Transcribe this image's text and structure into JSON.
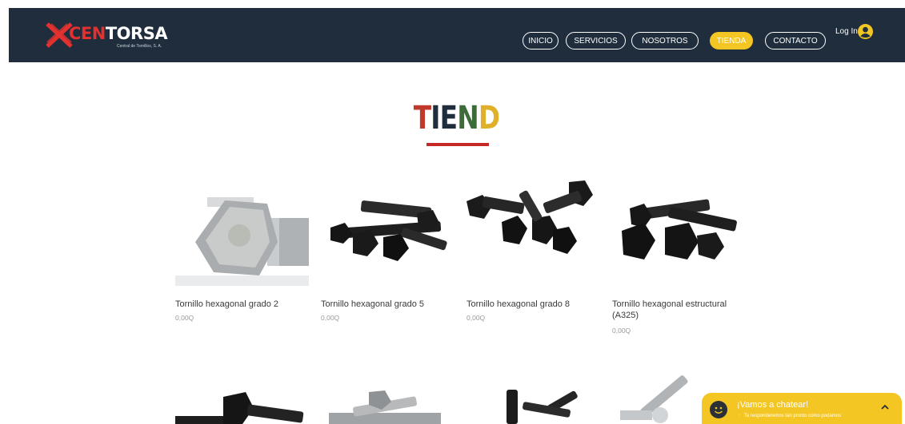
{
  "header": {
    "logo": {
      "brand_red": "CEN",
      "brand_white": "TORSA",
      "subtitle": "Central de Tornillos, S. A."
    },
    "nav": [
      {
        "label": "INICIO"
      },
      {
        "label": "SERVICIOS"
      },
      {
        "label": "NOSOTROS"
      },
      {
        "label": "TIENDA",
        "active": true
      },
      {
        "label": "CONTACTO"
      }
    ],
    "login_label": "Log In",
    "colors": {
      "background": "#1f2d3d",
      "accent": "#f3c623",
      "brand_red": "#e2312f"
    }
  },
  "page": {
    "title": "TIENDA"
  },
  "products": [
    {
      "name": "Tornillo hexagonal grado 2",
      "price": "0,00Q",
      "image": "zinc-hex-bolt"
    },
    {
      "name": "Tornillo hexagonal grado 5",
      "price": "0,00Q",
      "image": "black-hex-bolts"
    },
    {
      "name": "Tornillo hexagonal grado 8",
      "price": "0,00Q",
      "image": "black-hex-bolts-group"
    },
    {
      "name": "Tornillo hexagonal estructural (A325)",
      "price": "0,00Q",
      "image": "black-structural-bolts"
    }
  ],
  "chat": {
    "title": "¡Vamos a chatear!",
    "subtitle": "Te responderemos tan pronto como podamos",
    "icons": [
      "smile-icon",
      "lightning-icon",
      "chevron-up-icon"
    ]
  }
}
